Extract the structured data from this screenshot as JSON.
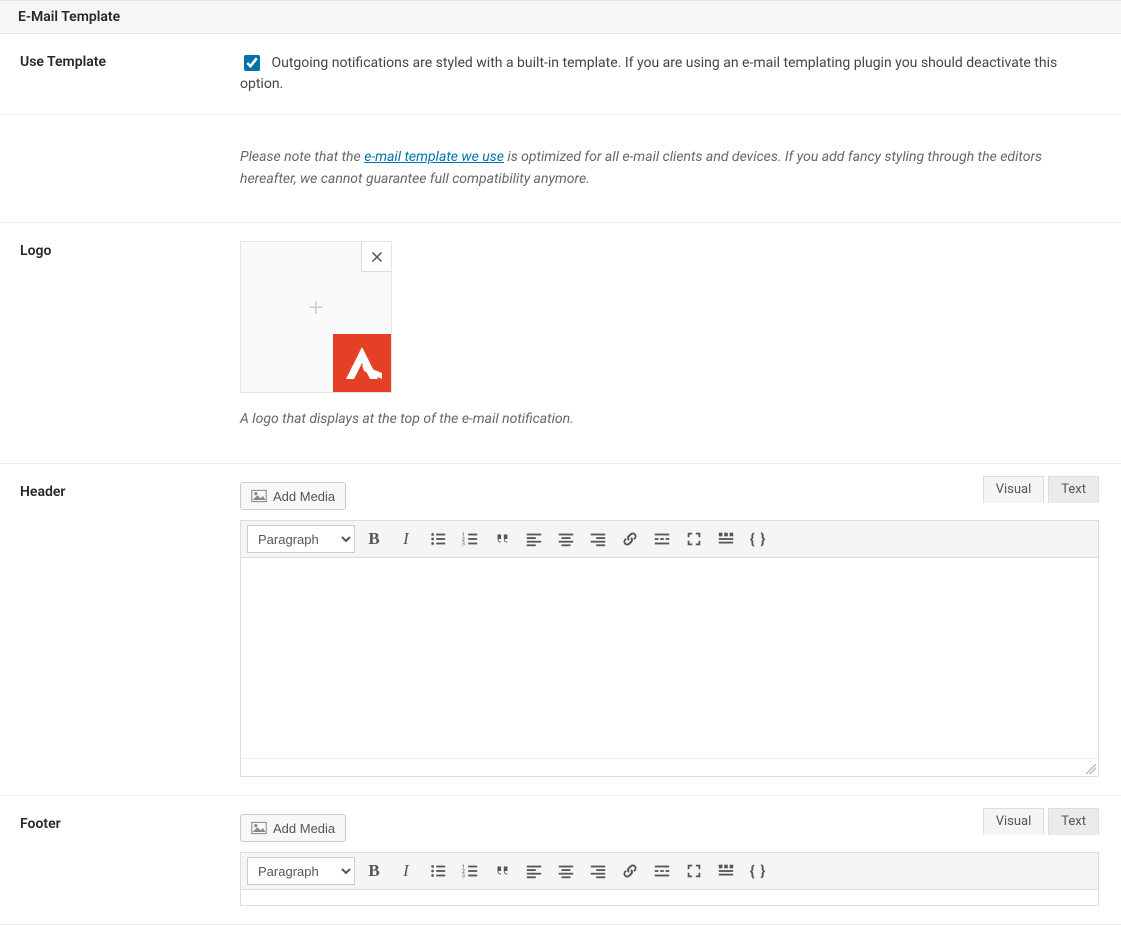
{
  "section_title": "E-Mail Template",
  "rows": {
    "use_template": {
      "label": "Use Template",
      "checked": true,
      "text": "Outgoing notifications are styled with a built-in template. If you are using an e-mail templating plugin you should deactivate this option."
    },
    "note": {
      "before": "Please note that the ",
      "link_text": "e-mail template we use",
      "after": " is optimized for all e-mail clients and devices. If you add fancy styling through the editors hereafter, we cannot guarantee full compatibility anymore."
    },
    "logo": {
      "label": "Logo",
      "help": "A logo that displays at the top of the e-mail notification."
    },
    "header": {
      "label": "Header"
    },
    "footer": {
      "label": "Footer"
    }
  },
  "editor": {
    "add_media": "Add Media",
    "tab_visual": "Visual",
    "tab_text": "Text",
    "format_select": "Paragraph"
  }
}
